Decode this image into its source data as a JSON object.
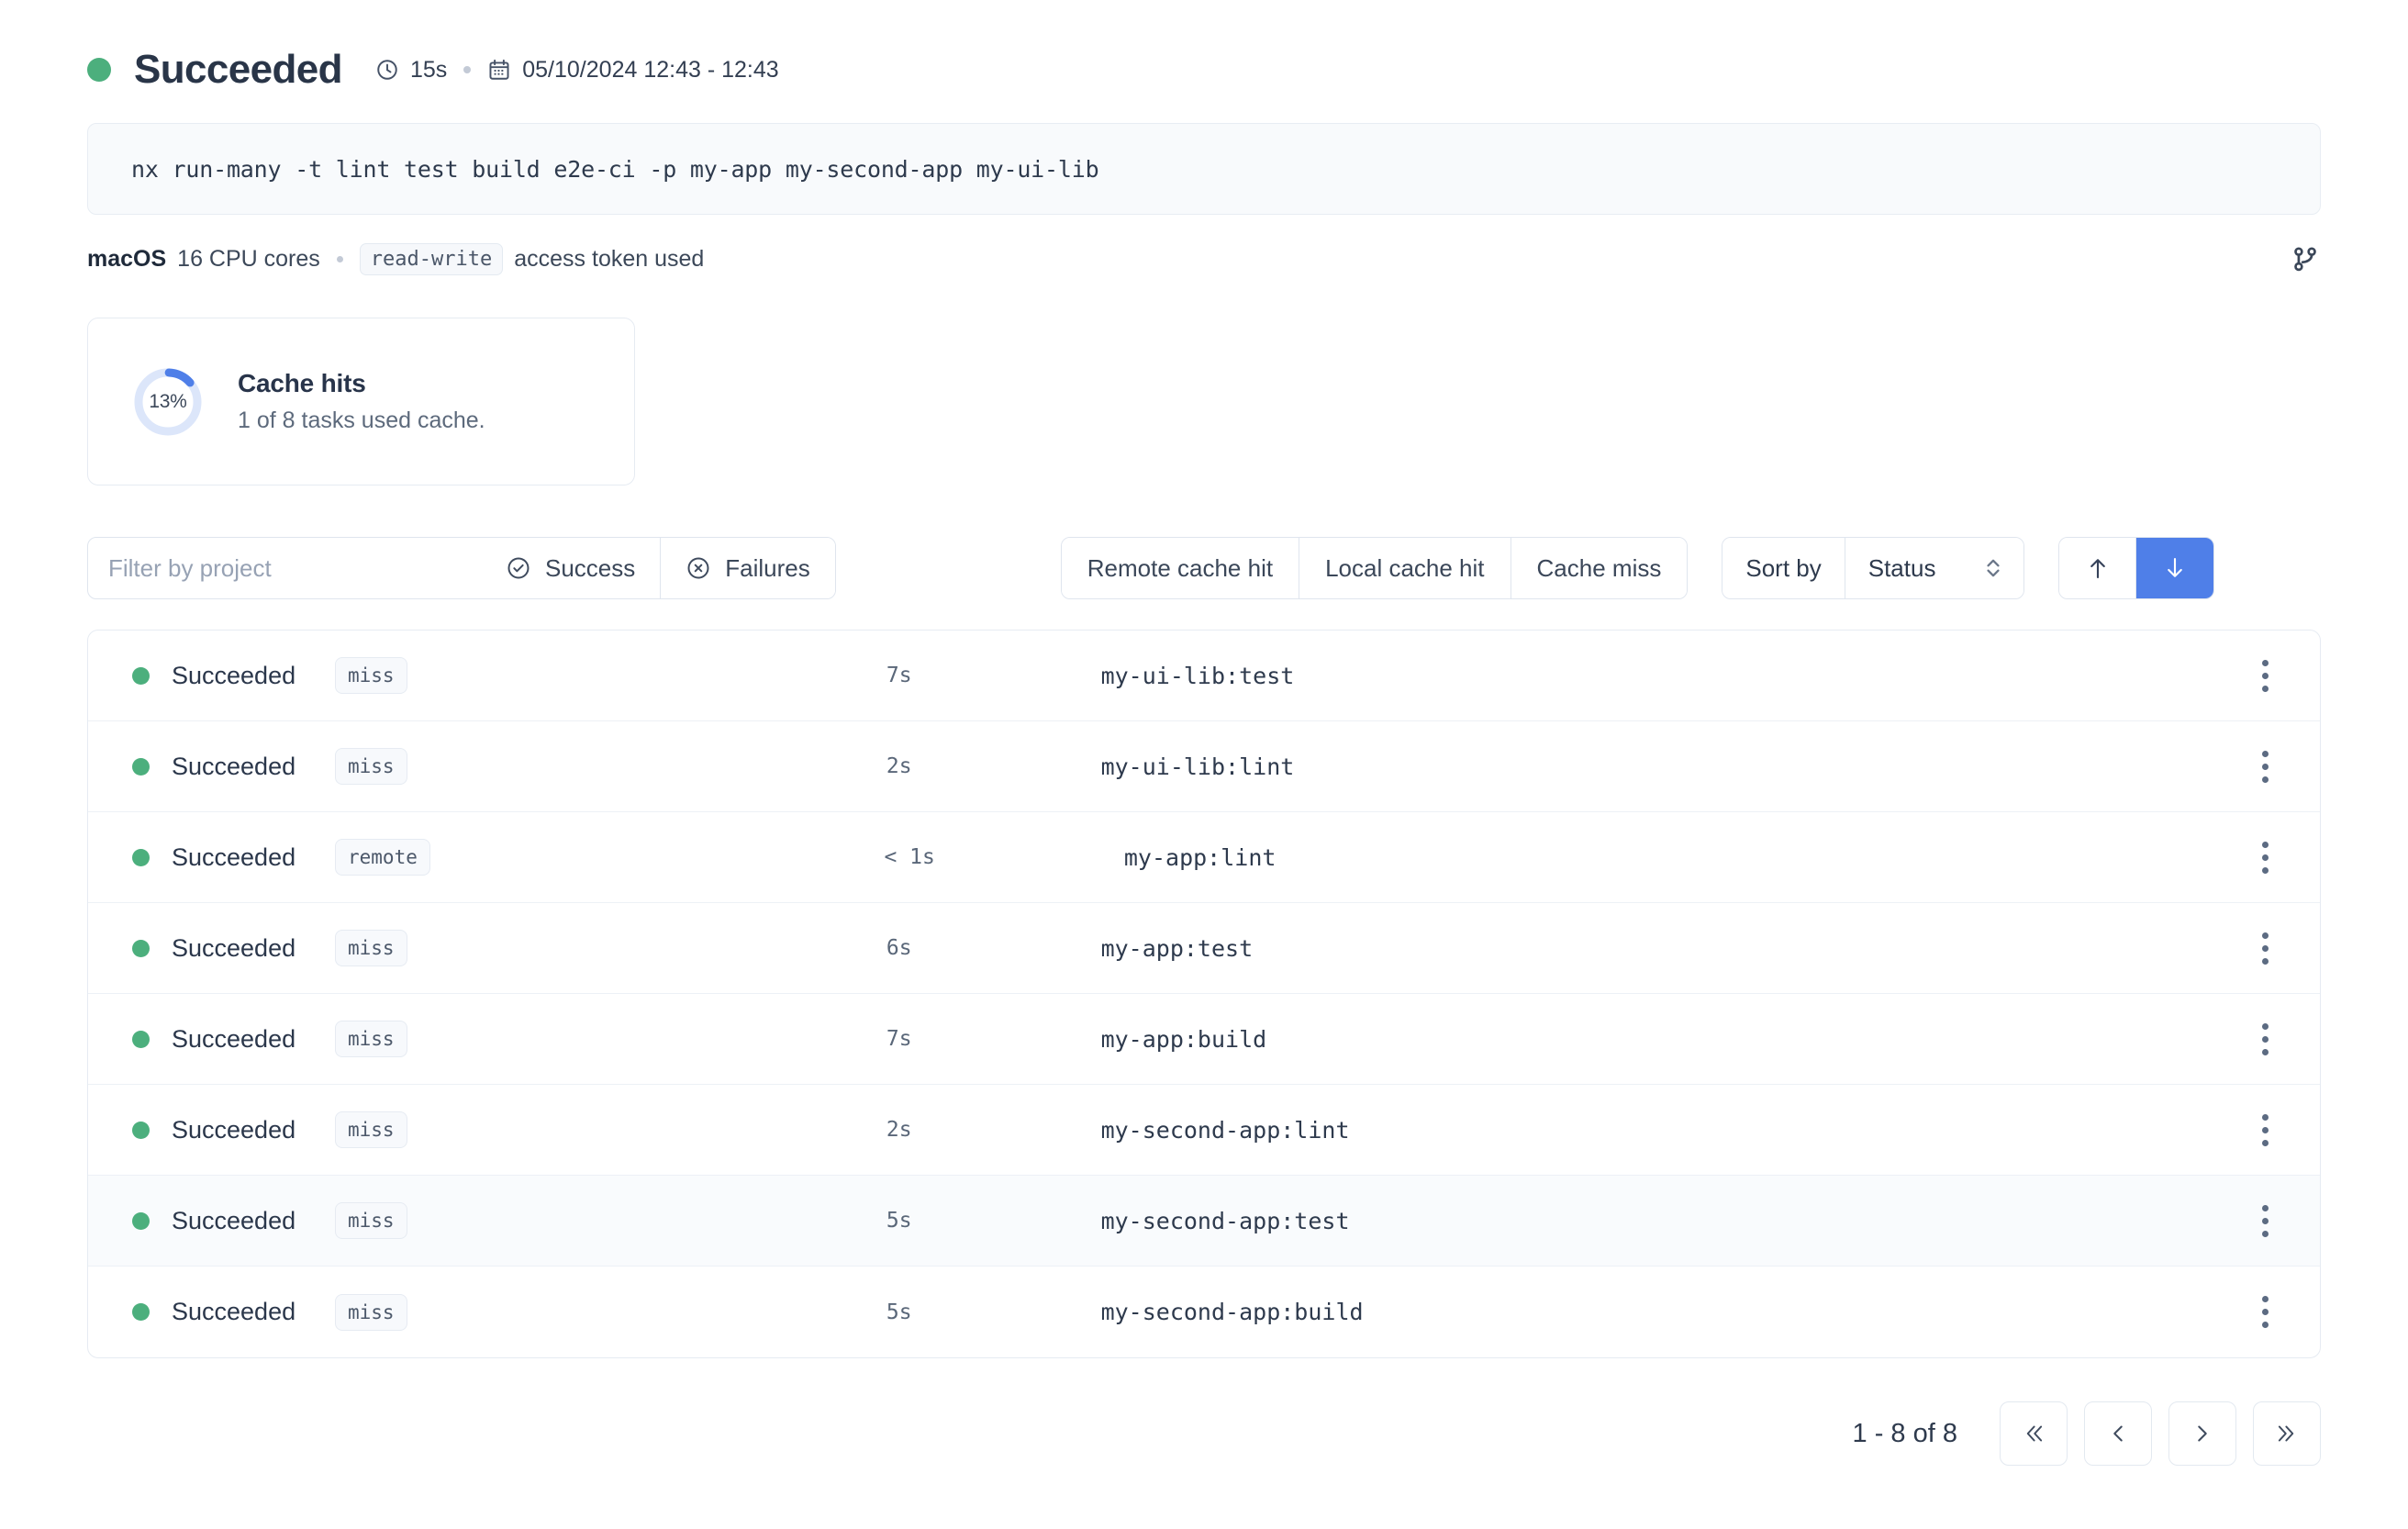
{
  "header": {
    "status": "Succeeded",
    "duration": "15s",
    "datetime": "05/10/2024 12:43 - 12:43",
    "clock_icon": "clock-icon",
    "calendar_icon": "calendar-icon",
    "branch_icon": "git-branch-icon",
    "status_color": "#4caf7d"
  },
  "command": {
    "text": "nx run-many -t lint test build e2e-ci -p my-app my-second-app my-ui-lib"
  },
  "environment": {
    "os": "macOS",
    "cpu": "16 CPU cores",
    "token_chip": "read-write",
    "token_text": "access token used"
  },
  "cache_card": {
    "percent_label": "13%",
    "percent_value": 13,
    "title": "Cache hits",
    "subtitle": "1 of 8 tasks used cache.",
    "arc_color": "#4f7fe8",
    "track_color": "#dce6fa"
  },
  "toolbar": {
    "filter_placeholder": "Filter by project",
    "filter_value": "",
    "success_label": "Success",
    "failures_label": "Failures",
    "remote_cache_hit_label": "Remote cache hit",
    "local_cache_hit_label": "Local cache hit",
    "cache_miss_label": "Cache miss",
    "sort_by_label": "Sort by",
    "sort_value": "Status",
    "sort_asc_icon": "arrow-up-icon",
    "sort_desc_icon": "arrow-down-icon",
    "active_direction": "desc",
    "active_color": "#4f7fe8"
  },
  "tasks": [
    {
      "status": "Succeeded",
      "cache": "miss",
      "duration": "7s",
      "name": "my-ui-lib:test",
      "highlight": false
    },
    {
      "status": "Succeeded",
      "cache": "miss",
      "duration": "2s",
      "name": "my-ui-lib:lint",
      "highlight": false
    },
    {
      "status": "Succeeded",
      "cache": "remote",
      "duration": "< 1s",
      "name": "my-app:lint",
      "highlight": false
    },
    {
      "status": "Succeeded",
      "cache": "miss",
      "duration": "6s",
      "name": "my-app:test",
      "highlight": false
    },
    {
      "status": "Succeeded",
      "cache": "miss",
      "duration": "7s",
      "name": "my-app:build",
      "highlight": false
    },
    {
      "status": "Succeeded",
      "cache": "miss",
      "duration": "2s",
      "name": "my-second-app:lint",
      "highlight": false
    },
    {
      "status": "Succeeded",
      "cache": "miss",
      "duration": "5s",
      "name": "my-second-app:test",
      "highlight": true
    },
    {
      "status": "Succeeded",
      "cache": "miss",
      "duration": "5s",
      "name": "my-second-app:build",
      "highlight": false
    }
  ],
  "pagination": {
    "range_label": "1 - 8 of 8",
    "first_icon": "chevron-double-left-icon",
    "prev_icon": "chevron-left-icon",
    "next_icon": "chevron-right-icon",
    "last_icon": "chevron-double-right-icon"
  }
}
